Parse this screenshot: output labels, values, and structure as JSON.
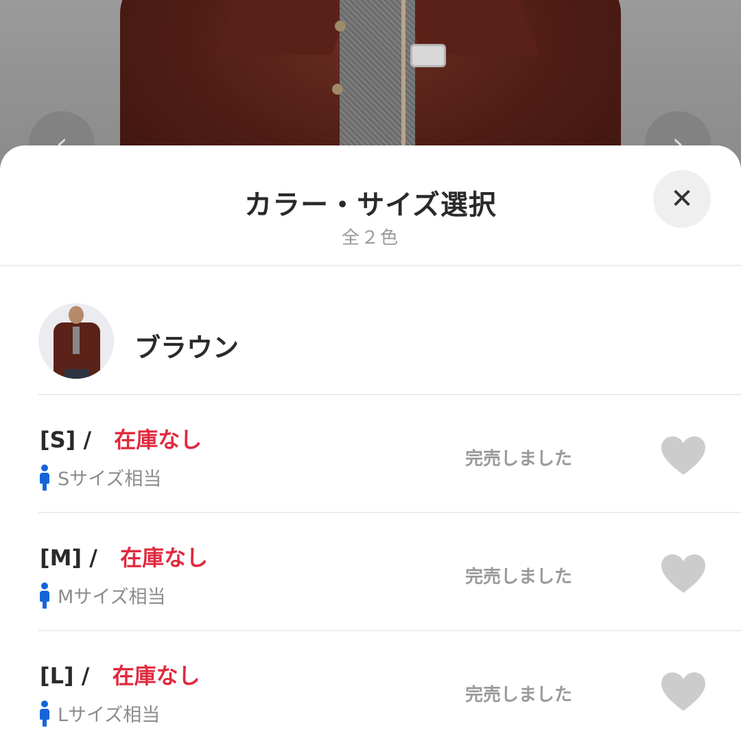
{
  "sheet": {
    "title": "カラー・サイズ選択",
    "subtitle": "全２色",
    "close_label": "✕"
  },
  "nav": {
    "prev_label": "‹",
    "next_label": "›"
  },
  "color": {
    "name": "ブラウン"
  },
  "sizes": [
    {
      "size": "[S]",
      "sep": "/",
      "stock": "在庫なし",
      "equiv": "Sサイズ相当",
      "status": "完売しました"
    },
    {
      "size": "[M]",
      "sep": "/",
      "stock": "在庫なし",
      "equiv": "Mサイズ相当",
      "status": "完売しました"
    },
    {
      "size": "[L]",
      "sep": "/",
      "stock": "在庫なし",
      "equiv": "Lサイズ相当",
      "status": "完売しました"
    }
  ],
  "colors": {
    "stock_red": "#e02a3e",
    "person_blue": "#1565d8",
    "heart_gray": "#cccccc"
  },
  "icons": {
    "person": "person-icon",
    "heart": "heart-icon",
    "close": "close-icon"
  }
}
